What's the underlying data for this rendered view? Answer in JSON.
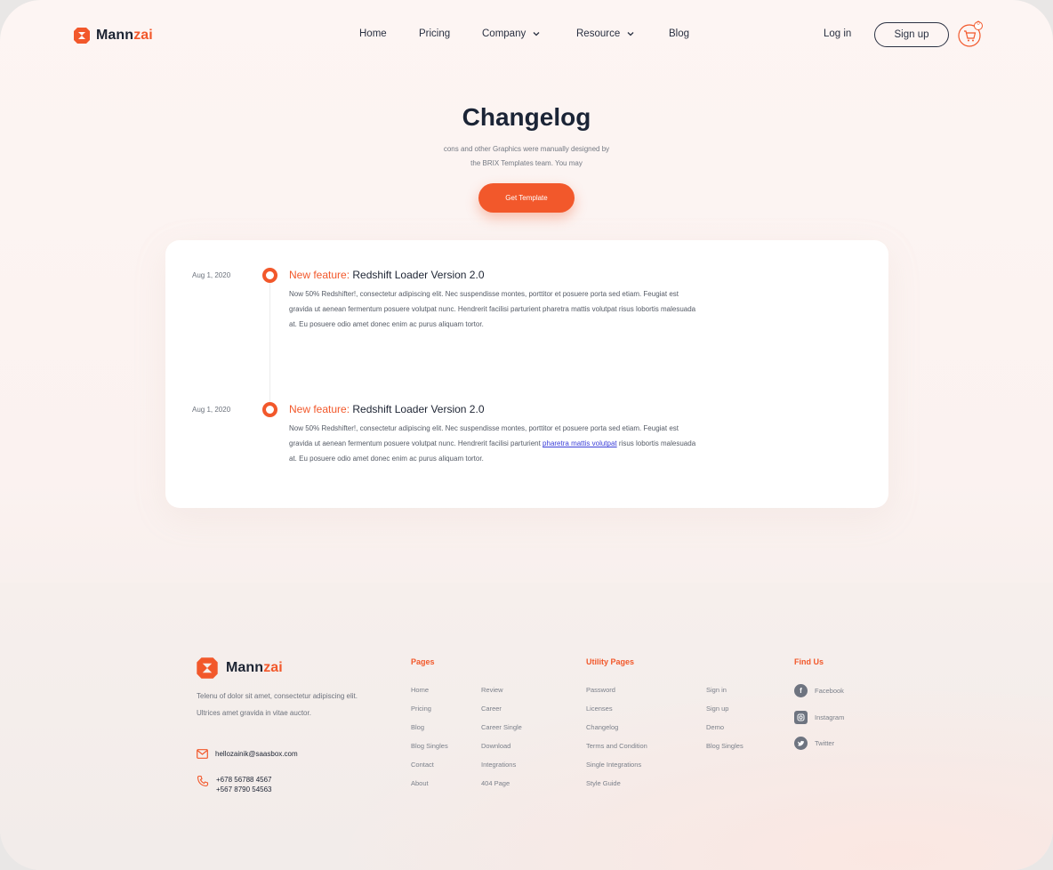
{
  "brand": {
    "name_part1": "Mann",
    "name_part2": "zai",
    "accent_color": "#f2582b"
  },
  "header": {
    "nav": [
      {
        "label": "Home",
        "has_dropdown": false
      },
      {
        "label": "Pricing",
        "has_dropdown": false
      },
      {
        "label": "Company",
        "has_dropdown": true
      },
      {
        "label": "Resource",
        "has_dropdown": true
      },
      {
        "label": "Blog",
        "has_dropdown": false
      }
    ],
    "login_label": "Log in",
    "signup_label": "Sign up",
    "cart_count": "0",
    "cart_icon": "cart-icon"
  },
  "hero": {
    "title": "Changelog",
    "subtitle_line1": "cons and other Graphics were manually designed by",
    "subtitle_line2": "the BRIX Templates team. You may",
    "cta_label": "Get Template"
  },
  "changelog": {
    "entries": [
      {
        "date": "Aug 1, 2020",
        "tag": "New feature:",
        "title": "Redshift Loader Version 2.0",
        "body": "Now 50% Redshifter!, consectetur adipiscing elit. Nec suspendisse montes, porttitor et posuere porta sed etiam. Feugiat est gravida ut aenean fermentum posuere volutpat nunc. Hendrerit facilisi parturient pharetra mattis volutpat risus lobortis malesuada at. Eu posuere odio amet donec enim ac purus aliquam tortor."
      },
      {
        "date": "Aug 1, 2020",
        "tag": "New feature:",
        "title": "Redshift Loader Version 2.0",
        "body_before_link": "Now 50% Redshifter!, consectetur adipiscing elit. Nec suspendisse montes, porttitor et posuere porta sed etiam. Feugiat est gravida ut aenean fermentum posuere volutpat nunc. Hendrerit facilisi parturient ",
        "link_text": "pharetra mattis volutpat",
        "body_after_link": " risus lobortis malesuada at. Eu posuere odio amet donec enim ac purus aliquam tortor."
      }
    ]
  },
  "footer": {
    "description": "Telenu of dolor sit amet, consectetur adipiscing elit. Ultrices amet gravida in vitae auctor.",
    "email": "hellozainik@saasbox.com",
    "phone1": "+678 56788 4567",
    "phone2": "+567 8790 54563",
    "pages_title": "Pages",
    "pages_col1": [
      "Home",
      "Pricing",
      "Blog",
      "Blog Singles",
      "Contact",
      "About"
    ],
    "pages_col2": [
      "Review",
      "Career",
      "Career Single",
      "Download",
      "Integrations",
      "404 Page"
    ],
    "utility_title": "Utility Pages",
    "utility_col1": [
      "Password",
      "Licenses",
      "Changelog",
      "Terms and Condition",
      "Single Integrations",
      "Style Guide"
    ],
    "utility_col2": [
      "Sign in",
      "Sign up",
      "Demo",
      "Blog Singles"
    ],
    "find_us_title": "Find Us",
    "social": [
      {
        "label": "Facebook",
        "icon": "facebook-icon"
      },
      {
        "label": "Instagram",
        "icon": "instagram-icon"
      },
      {
        "label": "Twitter",
        "icon": "twitter-icon"
      }
    ]
  }
}
